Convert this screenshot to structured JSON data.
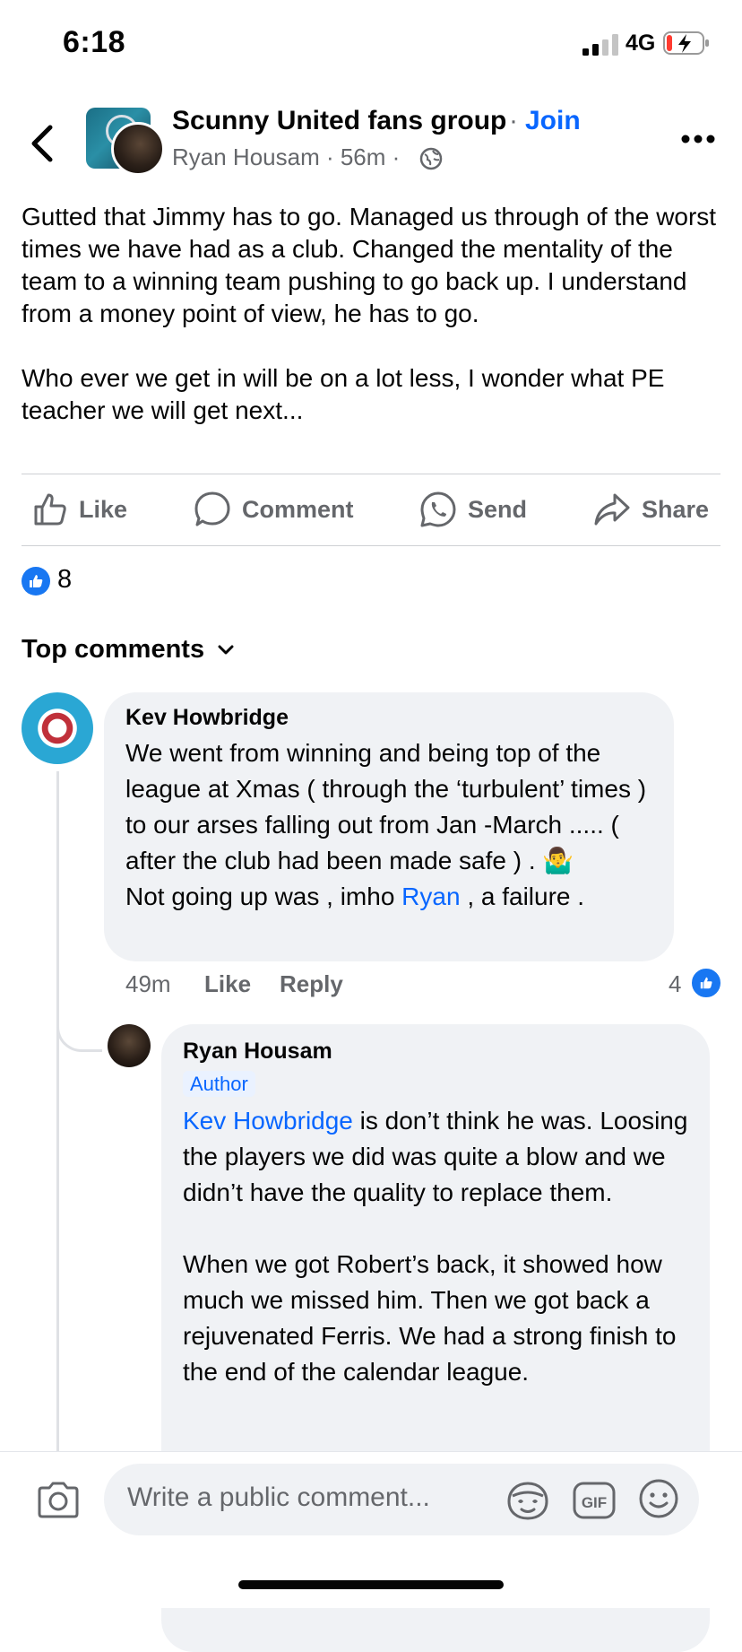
{
  "status_bar": {
    "time": "6:18",
    "network": "4G"
  },
  "header": {
    "group_name": "Scunny United fans group",
    "separator": "·",
    "join_label": "Join",
    "author": "Ryan Housam",
    "meta": "Ryan Housam · 56m ·",
    "time_ago": "56m"
  },
  "post": {
    "text": "Gutted that Jimmy has to go. Managed us through of the worst times we have had as a club. Changed the mentality of the team to a winning team pushing to go back up. I understand from a money point of view, he has to go.\n\nWho ever we get in will be on a lot less, I wonder what PE teacher we will get next..."
  },
  "actions": {
    "like": "Like",
    "comment": "Comment",
    "send": "Send",
    "share": "Share"
  },
  "reactions": {
    "count": "8"
  },
  "comments_header": "Top comments",
  "comments": [
    {
      "name": "Kev Howbridge",
      "text_before": "We went from winning and being top of the league at Xmas ( through the ‘turbulent’ times ) to our arses falling out from Jan -March ..... ( after the club had been made safe ) . 🤷‍♂️\nNot going up was , imho ",
      "mention": "Ryan",
      "text_after": " , a failure .",
      "time": "49m",
      "like_label": "Like",
      "reply_label": "Reply",
      "like_count": "4"
    },
    {
      "name": "Ryan Housam",
      "badge": "Author",
      "mention": "Kev Howbridge",
      "text": " is don’t think he was. Loosing the players we did was quite a blow and we didn’t have the quality to replace them.\n\nWhen we got Robert’s back, it showed how much we missed him. Then we got back a rejuvenated Ferris. We had a strong finish to the end of the calendar league."
    }
  ],
  "composer": {
    "placeholder": "Write a public comment..."
  },
  "colors": {
    "accent": "#0866ff",
    "like_blue": "#1877f2",
    "bubble": "#f0f2f5",
    "meta_grey": "#65676b"
  }
}
